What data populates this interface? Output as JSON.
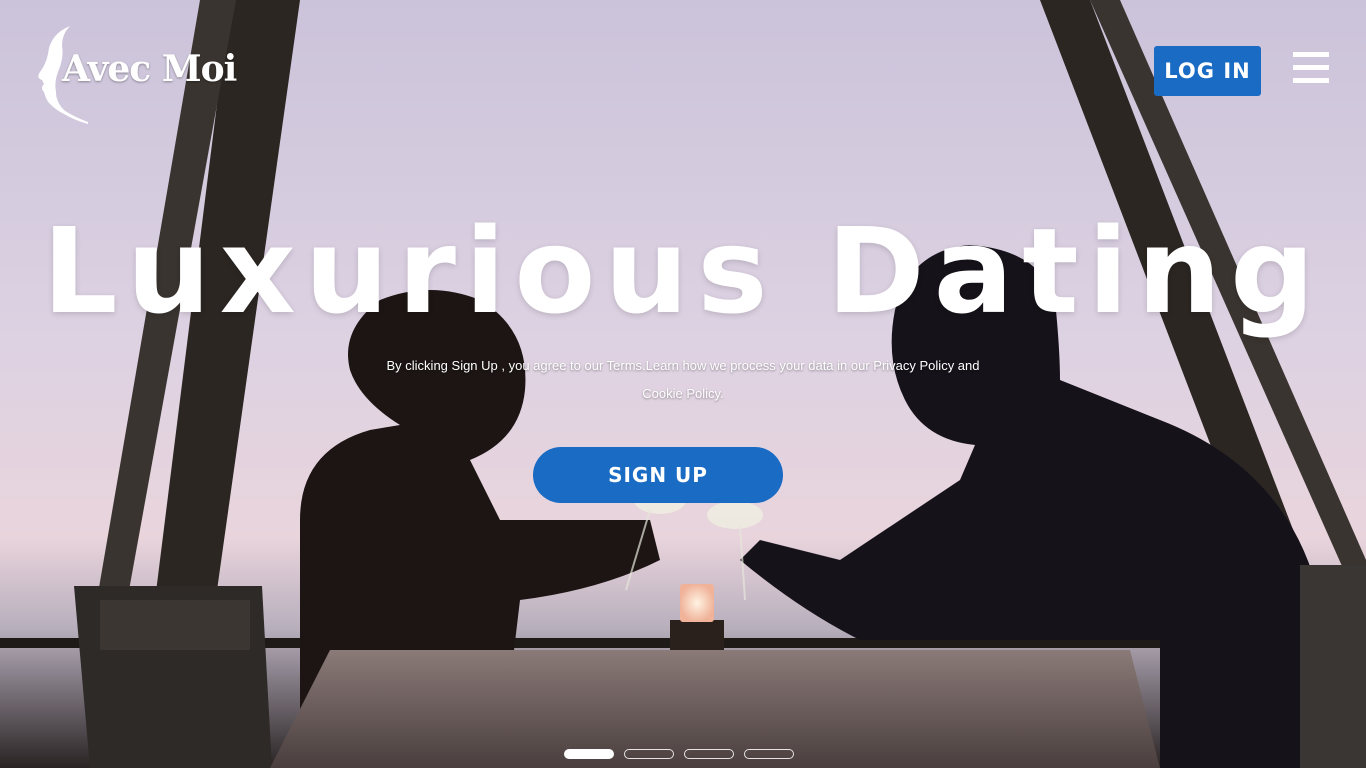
{
  "brand": {
    "name": "Avec Moi"
  },
  "header": {
    "login_label": "LOG IN",
    "menu_icon": "hamburger-menu-icon"
  },
  "hero": {
    "headline": "Luxurious Dating",
    "terms_text": "By clicking Sign Up , you agree to our Terms.Learn how we process your data in our Privacy Policy and Cookie Policy.",
    "signup_label": "SIGN UP"
  },
  "carousel": {
    "slide_count": 4,
    "active_index": 0
  },
  "colors": {
    "accent": "#1a6bc4",
    "text": "#ffffff"
  }
}
